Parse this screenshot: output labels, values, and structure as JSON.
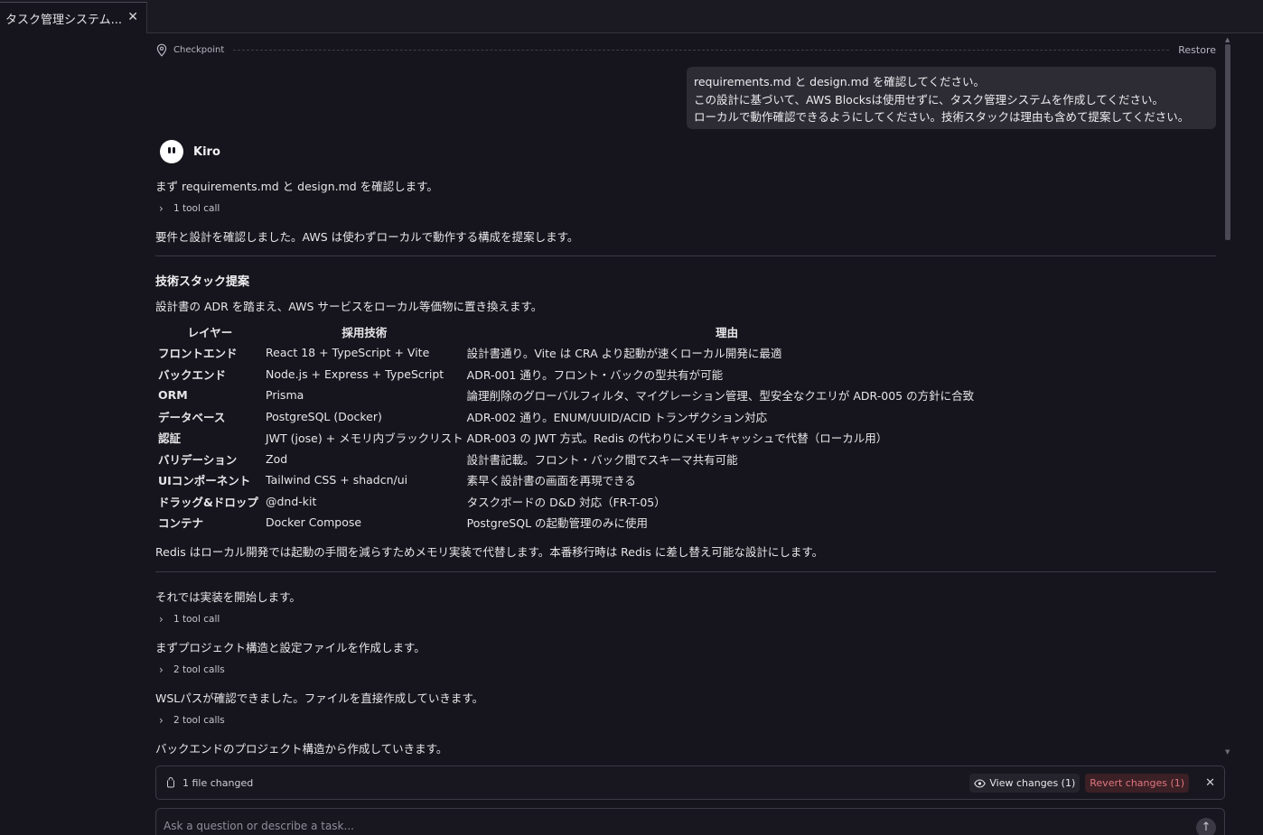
{
  "tab": {
    "title": "タスク管理システム...",
    "close": "✕"
  },
  "checkpoint": {
    "label": "Checkpoint",
    "restore": "Restore"
  },
  "user_message": {
    "lines": [
      "requirements.md と design.md を確認してください。",
      "この設計に基づいて、AWS Blocksは使用せずに、タスク管理システムを作成してください。",
      "ローカルで動作確認できるようにしてください。技術スタックは理由も含めて提案してください。"
    ]
  },
  "agent": {
    "name": "Kiro"
  },
  "messages": {
    "intro": "まず requirements.md と design.md を確認します。",
    "tool1": "1 tool call",
    "confirmed": "要件と設計を確認しました。AWS は使わずローカルで動作する構成を提案します。",
    "section_title": "技術スタック提案",
    "section_desc": "設計書の ADR を踏まえ、AWS サービスをローカル等価物に置き換えます。",
    "redis_note": "Redis はローカル開発では起動の手間を減らすためメモリ実装で代替します。本番移行時は Redis に差し替え可能な設計にします。",
    "start_impl": "それでは実装を開始します。",
    "tool2": "1 tool call",
    "project_struct": "まずプロジェクト構造と設定ファイルを作成します。",
    "tool3": "2 tool calls",
    "wsl": "WSLパスが確認できました。ファイルを直接作成していきます。",
    "tool4": "2 tool calls",
    "backend": "バックエンドのプロジェクト構造から作成していきます。"
  },
  "stack_table": {
    "headers": [
      "レイヤー",
      "採用技術",
      "理由"
    ],
    "rows": [
      [
        "フロントエンド",
        "React 18 + TypeScript + Vite",
        "設計書通り。Vite は CRA より起動が速くローカル開発に最適"
      ],
      [
        "バックエンド",
        "Node.js + Express + TypeScript",
        "ADR-001 通り。フロント・バックの型共有が可能"
      ],
      [
        "ORM",
        "Prisma",
        "論理削除のグローバルフィルタ、マイグレーション管理、型安全なクエリが ADR-005 の方針に合致"
      ],
      [
        "データベース",
        "PostgreSQL (Docker)",
        "ADR-002 通り。ENUM/UUID/ACID トランザクション対応"
      ],
      [
        "認証",
        "JWT (jose) + メモリ内ブラックリスト",
        "ADR-003 の JWT 方式。Redis の代わりにメモリキャッシュで代替（ローカル用）"
      ],
      [
        "バリデーション",
        "Zod",
        "設計書記載。フロント・バック間でスキーマ共有可能"
      ],
      [
        "UIコンポーネント",
        "Tailwind CSS + shadcn/ui",
        "素早く設計書の画面を再現できる"
      ],
      [
        "ドラッグ&ドロップ",
        "@dnd-kit",
        "タスクボードの D&D 対応（FR-T-05）"
      ],
      [
        "コンテナ",
        "Docker Compose",
        "PostgreSQL の起動管理のみに使用"
      ]
    ]
  },
  "changes": {
    "file_changed": "1 file changed",
    "view": "View changes (1)",
    "revert": "Revert changes (1)",
    "close": "✕"
  },
  "input": {
    "placeholder": "Ask a question or describe a task...",
    "send": "↑"
  },
  "icons": {
    "checkpoint": "map-pin-icon",
    "file": "file-icon",
    "view": "eye-icon",
    "chevron": "chevron-right-icon",
    "send": "arrow-up-icon"
  },
  "colors": {
    "background": "#16151d",
    "revert": "#e0767f",
    "bubble": "#2d2c35"
  }
}
